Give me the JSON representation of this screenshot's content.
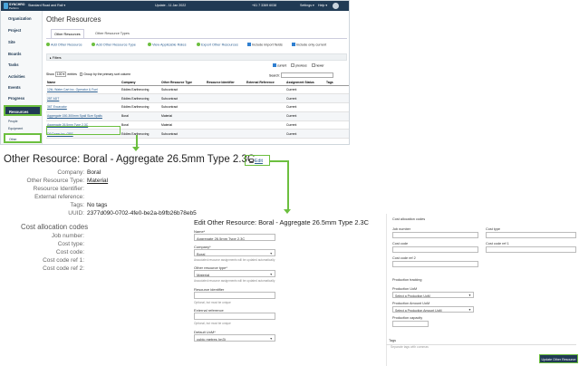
{
  "topbar": {
    "logo_line1": "SYNCHRO",
    "logo_line2": "Perform",
    "project": "Standard Road and Rail ▾",
    "update": "Update - 11 Jan 2022",
    "phone": "+61 7 3369 6038",
    "settings": "Settings ▾",
    "help": "Help ▾"
  },
  "sidebar": {
    "items": [
      "Organization",
      "Project",
      "Site",
      "Boards",
      "Tasks",
      "Activities",
      "Events",
      "Progress"
    ],
    "selected": "Resources",
    "subitems": [
      "People",
      "Equipment"
    ],
    "selected_sub": "Other"
  },
  "main": {
    "title": "Other Resources",
    "tabs": [
      "Other Resources",
      "Other Resource Types"
    ],
    "actions": [
      "Add Other Resource",
      "Add Other Resource Type",
      "View Applicable Rates",
      "Export Other Resources",
      "Include import fields",
      "Include only current"
    ],
    "filters_label": "▸ Filters",
    "status_filters": [
      "current",
      "previous",
      "newer"
    ],
    "show_prefix": "Show",
    "show_value": "100 ▾",
    "show_suffix": "entries",
    "group_label": "Group by the primary sort column",
    "search_label": "Search:",
    "columns": [
      "Name",
      "Company",
      "Other Resource Type",
      "Resource Identifier",
      "External Reference",
      "Assignment Status",
      "Tags"
    ],
    "rows": [
      [
        "12kL Water Cart inc. Operator & Fuel",
        "Eddies Earthmoving",
        "Subcontract",
        "",
        "",
        "Current",
        ""
      ],
      [
        "25T ADT",
        "Eddies Earthmoving",
        "Subcontract",
        "",
        "",
        "Current",
        ""
      ],
      [
        "36T Excavator",
        "Eddies Earthmoving",
        "Subcontract",
        "",
        "",
        "Current",
        ""
      ],
      [
        "Aggregate 150-300mm Spall Size Spalls",
        "Boral",
        "Material",
        "",
        "",
        "Current",
        ""
      ],
      [
        "Aggregate 26.5mm Type 2.3C",
        "Boral",
        "Material",
        "",
        "",
        "Current",
        ""
      ],
      [
        "D9 Dozer inc. GPS",
        "Eddies Earthmoving",
        "Subcontract",
        "",
        "",
        "Current",
        ""
      ]
    ]
  },
  "detail": {
    "title": "Other Resource: Boral - Aggregate 26.5mm Type 2.3C",
    "edit_label": "Edit",
    "fields": [
      {
        "label": "Company:",
        "value": "Boral"
      },
      {
        "label": "Other Resource Type:",
        "value": "Material"
      },
      {
        "label": "Resource Identifier:",
        "value": ""
      },
      {
        "label": "External reference:",
        "value": ""
      },
      {
        "label": "Tags:",
        "value": "No tags"
      },
      {
        "label": "UUID:",
        "value": "2377d090-0702-4fe0-be2a-b9fb26b78eb5"
      }
    ],
    "cost_title": "Cost allocation codes",
    "cost_fields": [
      "Job number:",
      "Cost type:",
      "Cost code:",
      "Cost code ref 1:",
      "Cost code ref 2:"
    ]
  },
  "edit": {
    "title": "Edit Other Resource: Boral - Aggregate 26.5mm Type 2.3C",
    "name_label": "Name*",
    "name_value": "Aggregate 26.5mm Type 2.3C",
    "company_label": "Company*",
    "company_value": "Boral",
    "company_help": "Associated resource assignments will be updated automatically",
    "type_label": "Other resource type*",
    "type_value": "Material",
    "type_help": "Associated resource assignments will be updated automatically",
    "ident_label": "Resource identifier",
    "ident_help": "Optional, but must be unique",
    "ext_label": "External reference",
    "ext_help": "Optional, but must be unique",
    "uom_label": "Default UoM*",
    "uom_value": "cubic metres (m3)"
  },
  "right": {
    "cost_title": "Cost allocation codes",
    "job_number": "Job number",
    "cost_type": "Cost type",
    "cost_code": "Cost code",
    "cost_code_ref1": "Cost code ref 1",
    "cost_code_ref2": "Cost code ref 2",
    "prod_title": "Production tracking",
    "prod_uom": "Production UoM",
    "prod_uom_value": "Select a Production UoM",
    "prod_amount_uom": "Production Amount UoM",
    "prod_amount_value": "Select a Production Amount UoM",
    "prod_capacity": "Production capacity",
    "tags_label": "Tags",
    "tags_placeholder": "Separate tags with commas",
    "update_button": "Update Other Resource"
  }
}
